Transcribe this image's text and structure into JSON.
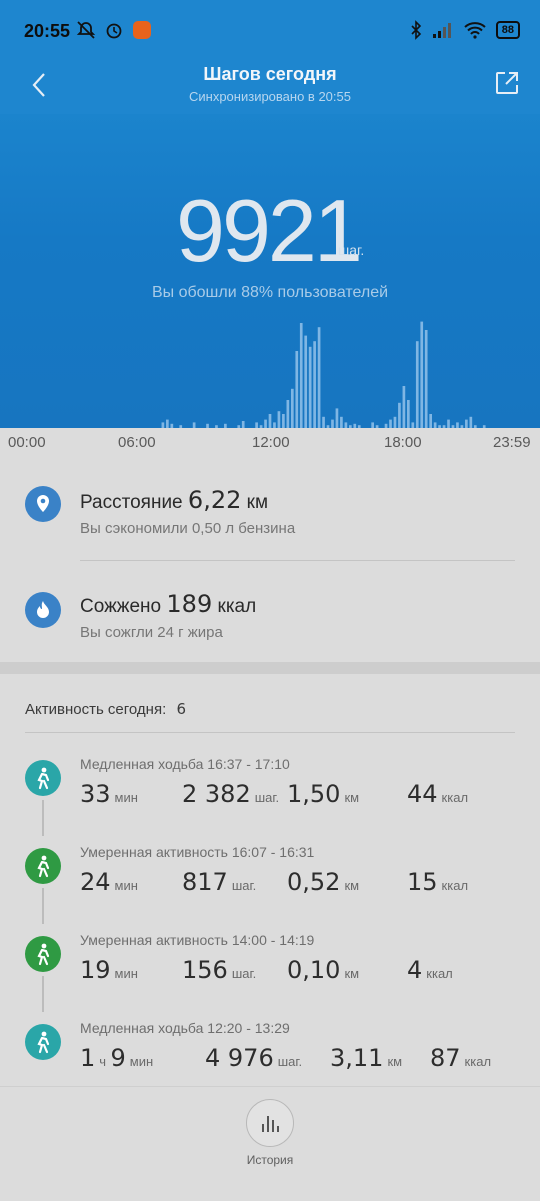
{
  "status": {
    "time": "20:55",
    "battery": "88"
  },
  "header": {
    "title": "Шагов сегодня",
    "subtitle": "Синхронизировано в 20:55"
  },
  "hero": {
    "steps": "9921",
    "unit": "шаг.",
    "comparison": "Вы обошли 88% пользователей"
  },
  "chart_data": {
    "type": "bar",
    "title": "",
    "xlabel": "",
    "ylabel": "",
    "x_ticks": [
      "00:00",
      "06:00",
      "12:00",
      "18:00",
      "23:59"
    ],
    "values": [
      0,
      0,
      0,
      0,
      0,
      0,
      0,
      0,
      0,
      0,
      0,
      0,
      0,
      0,
      0,
      0,
      0,
      0,
      0,
      0,
      0,
      0,
      0,
      0,
      0,
      0,
      0,
      0,
      0,
      0,
      0,
      0,
      0,
      0,
      0,
      0,
      4,
      6,
      3,
      0,
      2,
      0,
      0,
      4,
      0,
      0,
      3,
      0,
      2,
      0,
      3,
      0,
      0,
      2,
      5,
      0,
      0,
      4,
      2,
      6,
      10,
      4,
      12,
      10,
      20,
      28,
      55,
      75,
      66,
      58,
      62,
      72,
      8,
      2,
      6,
      14,
      8,
      4,
      2,
      3,
      2,
      0,
      0,
      4,
      2,
      0,
      3,
      6,
      8,
      18,
      30,
      20,
      4,
      62,
      76,
      70,
      10,
      4,
      2,
      2,
      6,
      2,
      4,
      2,
      6,
      8,
      2,
      0,
      2,
      0,
      0,
      0,
      0,
      0,
      0,
      0,
      0,
      0,
      0,
      0,
      0
    ],
    "ylim": [
      0,
      80
    ]
  },
  "summary": {
    "distance_prefix": "Расстояние",
    "distance_value": "6,22",
    "distance_unit": "км",
    "distance_sub": "Вы сэкономили 0,50 л бензина",
    "calories_prefix": "Сожжено",
    "calories_value": "189",
    "calories_unit": "ккал",
    "calories_sub": "Вы сожгли 24 г жира"
  },
  "activity": {
    "heading": "Активность сегодня:",
    "count": "6",
    "items": [
      {
        "title": "Медленная ходьба 16:37 - 17:10",
        "min": "33",
        "min_unit": "мин",
        "steps": "2 382",
        "steps_unit": "шаг.",
        "km": "1,50",
        "km_unit": "км",
        "kcal": "44",
        "kcal_unit": "ккал",
        "color": "#2aa6a8"
      },
      {
        "title": "Умеренная активность 16:07 - 16:31",
        "min": "24",
        "min_unit": "мин",
        "steps": "817",
        "steps_unit": "шаг.",
        "km": "0,52",
        "km_unit": "км",
        "kcal": "15",
        "kcal_unit": "ккал",
        "color": "#2f9a43"
      },
      {
        "title": "Умеренная активность 14:00 - 14:19",
        "min": "19",
        "min_unit": "мин",
        "steps": "156",
        "steps_unit": "шаг.",
        "km": "0,10",
        "km_unit": "км",
        "kcal": "4",
        "kcal_unit": "ккал",
        "color": "#2f9a43"
      },
      {
        "title": "Медленная ходьба 12:20 - 13:29",
        "hours": "1",
        "hours_unit": "ч",
        "min": "9",
        "min_unit": "мин",
        "steps": "4 976",
        "steps_unit": "шаг.",
        "km": "3,11",
        "km_unit": "км",
        "kcal": "87",
        "kcal_unit": "ккал",
        "color": "#2aa6a8"
      }
    ]
  },
  "bottom": {
    "history_label": "История"
  }
}
